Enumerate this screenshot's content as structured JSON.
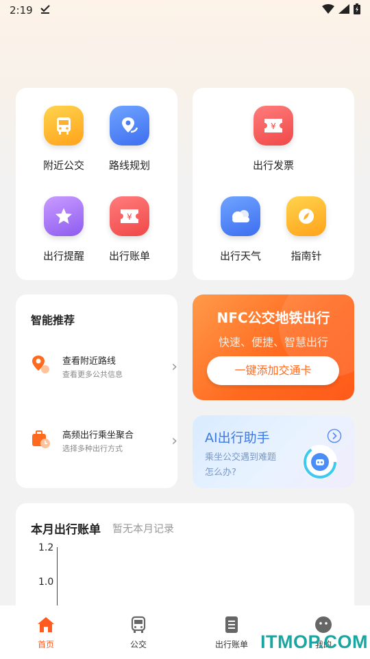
{
  "status": {
    "time": "2:19"
  },
  "quick_left": [
    {
      "label": "附近公交",
      "icon": "bus-icon"
    },
    {
      "label": "路线规划",
      "icon": "route-icon"
    },
    {
      "label": "出行提醒",
      "icon": "star-icon"
    },
    {
      "label": "出行账单",
      "icon": "ticket-yen-icon"
    }
  ],
  "quick_right": [
    {
      "label": "出行发票",
      "icon": "invoice-yen-icon"
    },
    {
      "label": "出行天气",
      "icon": "cloud-icon"
    },
    {
      "label": "指南针",
      "icon": "compass-icon"
    }
  ],
  "recommend": {
    "title": "智能推荐",
    "items": [
      {
        "title": "查看附近路线",
        "subtitle": "查看更多公共信息"
      },
      {
        "title": "高频出行乘坐聚合",
        "subtitle": "选择多种出行方式"
      }
    ]
  },
  "nfc": {
    "title": "NFC公交地铁出行",
    "subtitle": "快速、便捷、智慧出行",
    "button": "一键添加交通卡"
  },
  "ai": {
    "title": "AI出行助手",
    "text_line1": "乘坐公交遇到难题",
    "text_line2": "怎么办?"
  },
  "bill": {
    "title": "本月出行账单",
    "empty_note": "暂无本月记录",
    "y_ticks": [
      "1.2",
      "1.0"
    ]
  },
  "nav": {
    "items": [
      {
        "label": "首页",
        "icon": "home-icon",
        "active": true
      },
      {
        "label": "公交",
        "icon": "bus-icon"
      },
      {
        "label": "出行账单",
        "icon": "bill-icon"
      },
      {
        "label": "我的",
        "icon": "profile-icon"
      }
    ]
  },
  "watermark": "ITMOP.COM",
  "colors": {
    "accent": "#ff6a1f",
    "nav_active": "#ff5a1f"
  }
}
